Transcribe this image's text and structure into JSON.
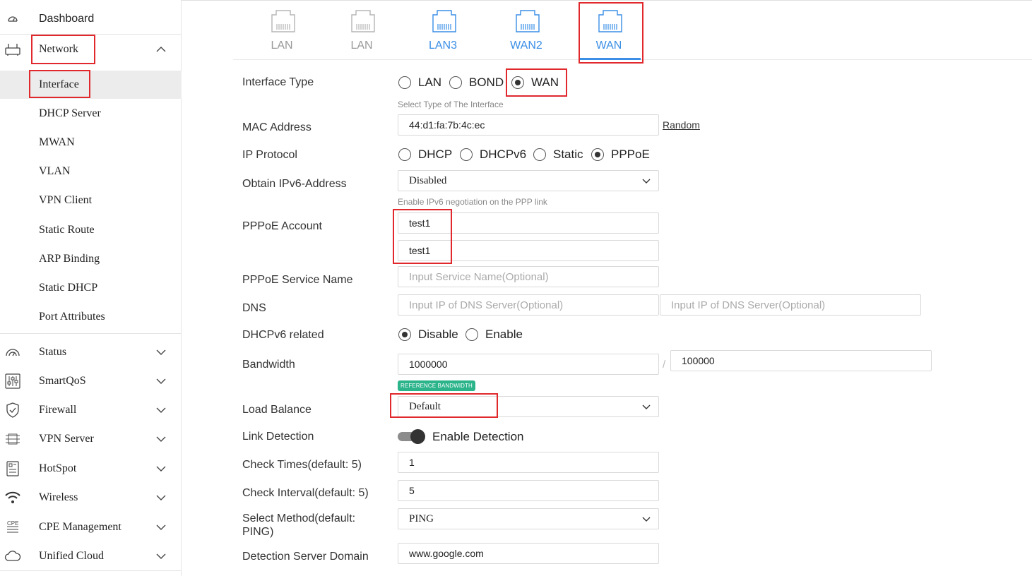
{
  "sidebar": {
    "dashboard": "Dashboard",
    "network": "Network",
    "network_items": [
      "Interface",
      "DHCP Server",
      "MWAN",
      "VLAN",
      "VPN Client",
      "Static Route",
      "ARP Binding",
      "Static DHCP",
      "Port Attributes"
    ],
    "groups": [
      "Status",
      "SmartQoS",
      "Firewall",
      "VPN Server",
      "HotSpot",
      "Wireless",
      "CPE Management",
      "Unified Cloud"
    ],
    "active_item": "Interface"
  },
  "tabs": [
    {
      "label": "LAN",
      "active": false
    },
    {
      "label": "LAN",
      "active": false
    },
    {
      "label": "LAN3",
      "active": false
    },
    {
      "label": "WAN2",
      "active": false
    },
    {
      "label": "WAN",
      "active": true
    }
  ],
  "form": {
    "interface_type": {
      "label": "Interface Type",
      "options": [
        "LAN",
        "BOND",
        "WAN"
      ],
      "selected": "WAN",
      "hint": "Select Type of The Interface"
    },
    "mac_address": {
      "label": "MAC Address",
      "value": "44:d1:fa:7b:4c:ec",
      "random_link": "Random"
    },
    "ip_protocol": {
      "label": "IP Protocol",
      "options": [
        "DHCP",
        "DHCPv6",
        "Static",
        "PPPoE"
      ],
      "selected": "PPPoE"
    },
    "obtain_ipv6": {
      "label": "Obtain IPv6-Address",
      "value": "Disabled",
      "hint": "Enable IPv6 negotiation on the PPP link"
    },
    "pppoe_account": {
      "label": "PPPoE Account",
      "username": "test1",
      "password": "test1"
    },
    "pppoe_service": {
      "label": "PPPoE Service Name",
      "placeholder": "Input Service Name(Optional)"
    },
    "dns": {
      "label": "DNS",
      "placeholder1": "Input IP of DNS Server(Optional)",
      "placeholder2": "Input IP of DNS Server(Optional)"
    },
    "dhcpv6_related": {
      "label": "DHCPv6 related",
      "options": [
        "Disable",
        "Enable"
      ],
      "selected": "Disable"
    },
    "bandwidth": {
      "label": "Bandwidth",
      "down": "1000000",
      "separator": "/",
      "up": "100000",
      "badge": "REFERENCE BANDWIDTH"
    },
    "load_balance": {
      "label": "Load Balance",
      "value": "Default"
    },
    "link_detection": {
      "label": "Link Detection",
      "toggle_label": "Enable Detection",
      "enabled": true
    },
    "check_times": {
      "label": "Check Times(default: 5)",
      "value": "1"
    },
    "check_interval": {
      "label": "Check Interval(default: 5)",
      "value": "5"
    },
    "select_method": {
      "label_line1": "Select Method(default:",
      "label_line2": "PING)",
      "value": "PING"
    },
    "detection_server": {
      "label": "Detection Server Domain",
      "value": "www.google.com"
    }
  },
  "colors": {
    "accent": "#3a8ee6",
    "highlight_box": "#e0282d",
    "badge": "#2bb38a"
  }
}
